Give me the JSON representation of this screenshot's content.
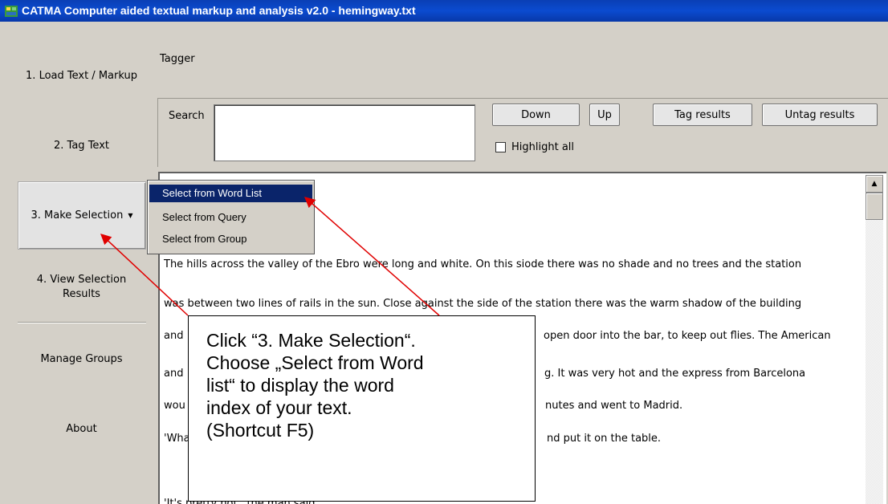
{
  "window": {
    "title": "CATMA Computer aided textual markup and analysis v2.0  - hemingway.txt"
  },
  "nav": {
    "load": "1. Load Text / Markup",
    "tag": "2. Tag Text",
    "make": "3. Make Selection",
    "view_line1": "4. View Selection",
    "view_line2": "Results",
    "groups": "Manage Groups",
    "about": "About"
  },
  "tagger": {
    "title": "Tagger",
    "search_label": "Search",
    "search_value": "",
    "down": "Down",
    "up": "Up",
    "tag_results": "Tag results",
    "untag_results": "Untag results",
    "highlight_all": "Highlight all",
    "highlight_checked": false
  },
  "menu": {
    "items": [
      "Select from Word List",
      "Select from Query",
      "Select from Group"
    ],
    "selected": "Select from Word List"
  },
  "text_lines": [
    "The hills across the valley of the Ebro were long and white. On this siode there was no shade and no trees and the station",
    "was between two lines of rails in the sun. Close against the side of the station there was the warm shadow of the building",
    "and",
    "open door into the bar, to keep out flies. The American",
    "and",
    "g. It was very hot and the express from Barcelona",
    "wou",
    "nutes and went to Madrid.",
    "'Wha",
    "nd put it on the table.",
    "'It's pretty hot,' the man said."
  ],
  "callout": {
    "lines": [
      "Click “3. Make Selection“.",
      "Choose „Select from Word",
      "list“ to display the word",
      "index of your text.",
      "(Shortcut F5)"
    ]
  },
  "colors": {
    "title_bar": "#0b4bd0",
    "menu_highlight": "#0a246a",
    "arrow": "#e00000",
    "window_bg": "#d4d0c8"
  }
}
